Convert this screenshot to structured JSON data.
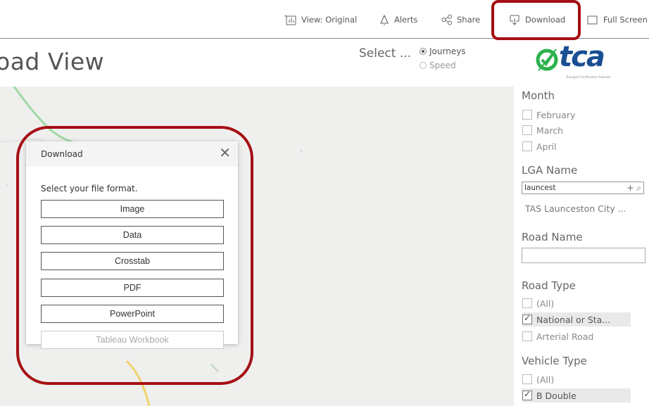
{
  "toolbar": {
    "view_label": "View: Original",
    "alerts_label": "Alerts",
    "share_label": "Share",
    "download_label": "Download",
    "fullscreen_label": "Full Screen"
  },
  "dashboard": {
    "title": "oad View",
    "select_label": "Select ...",
    "metric_options": [
      "Journeys",
      "Speed"
    ],
    "selected_metric": "Journeys"
  },
  "logo": {
    "text": "tca",
    "tagline": "Transport Certification Australia",
    "brand_color": "#2bb24c"
  },
  "filters": {
    "month": {
      "title": "Month",
      "options": [
        "February",
        "March",
        "April"
      ]
    },
    "lga": {
      "title": "LGA Name",
      "search_value": "launcest",
      "result": "TAS Launceston City ..."
    },
    "road_name": {
      "title": "Road Name",
      "value": ""
    },
    "road_type": {
      "title": "Road Type",
      "options": [
        {
          "label": "(All)",
          "checked": false
        },
        {
          "label": "National or Sta...",
          "checked": true
        },
        {
          "label": "Arterial Road",
          "checked": false
        }
      ]
    },
    "vehicle_type": {
      "title": "Vehicle Type",
      "options": [
        {
          "label": "(All)",
          "checked": false
        },
        {
          "label": "B Double",
          "checked": true
        }
      ]
    }
  },
  "download_dialog": {
    "title": "Download",
    "prompt": "Select your file format.",
    "buttons": [
      "Image",
      "Data",
      "Crosstab",
      "PDF",
      "PowerPoint",
      "Tableau Workbook"
    ],
    "disabled_button": "Tableau Workbook"
  },
  "colors": {
    "annotation": "#a50f14",
    "map_background": "#efefee",
    "map_river": "#9fd9a5",
    "map_highway": "#f0d36a"
  }
}
